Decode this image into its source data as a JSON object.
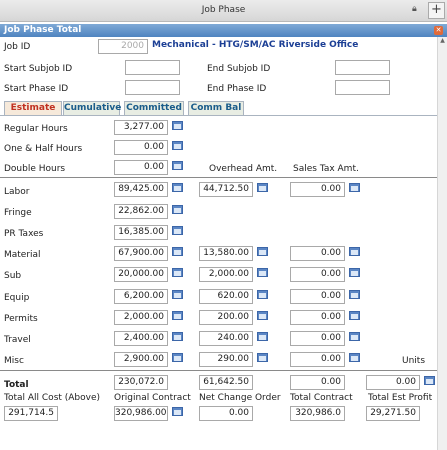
{
  "window": {
    "title": "Job Phase"
  },
  "panel": {
    "title": "Job Phase Total"
  },
  "job": {
    "label": "Job ID",
    "value": "2000",
    "description": "Mechanical - HTG/SM/AC Riverside Office"
  },
  "filters": {
    "start_subjob_label": "Start Subjob ID",
    "end_subjob_label": "End Subjob ID",
    "start_phase_label": "Start Phase ID",
    "end_phase_label": "End Phase ID",
    "start_subjob": "",
    "end_subjob": "",
    "start_phase": "",
    "end_phase": ""
  },
  "tabs": [
    "Estimate",
    "Cumulative",
    "Committed",
    "Comm Bal"
  ],
  "hours": {
    "regular_label": "Regular Hours",
    "regular": "3,277.00",
    "one_half_label": "One & Half Hours",
    "one_half": "0.00",
    "double_label": "Double Hours",
    "double": "0.00",
    "overhead_label": "Overhead Amt.",
    "sales_tax_label": "Sales Tax Amt."
  },
  "costs": {
    "labor": {
      "label": "Labor",
      "amount": "89,425.00",
      "overhead": "44,712.50",
      "tax": "0.00"
    },
    "fringe": {
      "label": "Fringe",
      "amount": "22,862.00"
    },
    "pr_taxes": {
      "label": "PR Taxes",
      "amount": "16,385.00"
    },
    "material": {
      "label": "Material",
      "amount": "67,900.00",
      "overhead": "13,580.00",
      "tax": "0.00"
    },
    "sub": {
      "label": "Sub",
      "amount": "20,000.00",
      "overhead": "2,000.00",
      "tax": "0.00"
    },
    "equip": {
      "label": "Equip",
      "amount": "6,200.00",
      "overhead": "620.00",
      "tax": "0.00"
    },
    "permits": {
      "label": "Permits",
      "amount": "2,000.00",
      "overhead": "200.00",
      "tax": "0.00"
    },
    "travel": {
      "label": "Travel",
      "amount": "2,400.00",
      "overhead": "240.00",
      "tax": "0.00"
    },
    "misc": {
      "label": "Misc",
      "amount": "2,900.00",
      "overhead": "290.00",
      "tax": "0.00"
    },
    "units_label": "Units"
  },
  "totals": {
    "label": "Total",
    "amount": "230,072.0",
    "overhead": "61,642.50",
    "tax": "0.00",
    "units": "0.00",
    "all_cost_label": "Total All Cost (Above)",
    "all_cost": "291,714.5",
    "orig_contract_label": "Original Contract",
    "orig_contract": "320,986.00",
    "net_change_label": "Net Change Order",
    "net_change": "0.00",
    "total_contract_label": "Total Contract",
    "total_contract": "320,986.0",
    "est_profit_label": "Total Est Profit",
    "est_profit": "29,271.50"
  }
}
